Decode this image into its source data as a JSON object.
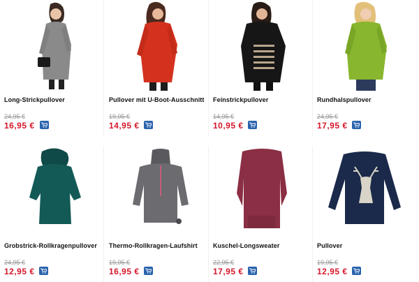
{
  "products": [
    {
      "name": "Long-Strickpullover",
      "old_price": "24,95 €",
      "price": "16,95 €",
      "icon": "cart-icon"
    },
    {
      "name": "Pullover mit U-Boot-Ausschnitt",
      "old_price": "19,95 €",
      "price": "14,95 €",
      "icon": "cart-icon"
    },
    {
      "name": "Feinstrickpullover",
      "old_price": "14,95 €",
      "price": "10,95 €",
      "icon": "cart-icon"
    },
    {
      "name": "Rundhalspullover",
      "old_price": "24,95 €",
      "price": "17,95 €",
      "icon": "cart-icon"
    },
    {
      "name": "Grobstrick-Rollkragenpullover",
      "old_price": "24,95 €",
      "price": "12,95 €",
      "icon": "cart-icon"
    },
    {
      "name": "Thermo-Rollkragen-Laufshirt",
      "old_price": "19,95 €",
      "price": "16,95 €",
      "icon": "cart-icon"
    },
    {
      "name": "Kuschel-Longsweater",
      "old_price": "22,95 €",
      "price": "17,95 €",
      "icon": "cart-icon"
    },
    {
      "name": "Pullover",
      "old_price": "19,95 €",
      "price": "12,95 €",
      "icon": "cart-icon"
    }
  ],
  "colors": {
    "price": "#d6162a",
    "old_price": "#999999",
    "cart_button": "#2a63ad"
  }
}
